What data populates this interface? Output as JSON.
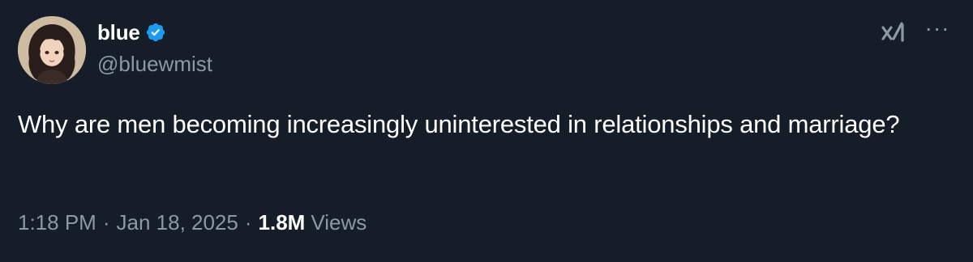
{
  "author": {
    "display_name": "blue",
    "handle": "@bluewmist",
    "verified": true,
    "avatar": "anime-character-avatar"
  },
  "header_icons": {
    "grok": "xai-grok-icon",
    "more": "···"
  },
  "tweet": {
    "text": "Why are men becoming increasingly uninterested in relationships and marriage?"
  },
  "meta": {
    "time": "1:18 PM",
    "separator": "·",
    "date": "Jan 18, 2025",
    "views_count": "1.8M",
    "views_label": "Views"
  },
  "colors": {
    "background": "#151d29",
    "primary_text": "#ffffff",
    "secondary_text": "#8b98a5",
    "verified_badge": "#1d9bf0"
  }
}
